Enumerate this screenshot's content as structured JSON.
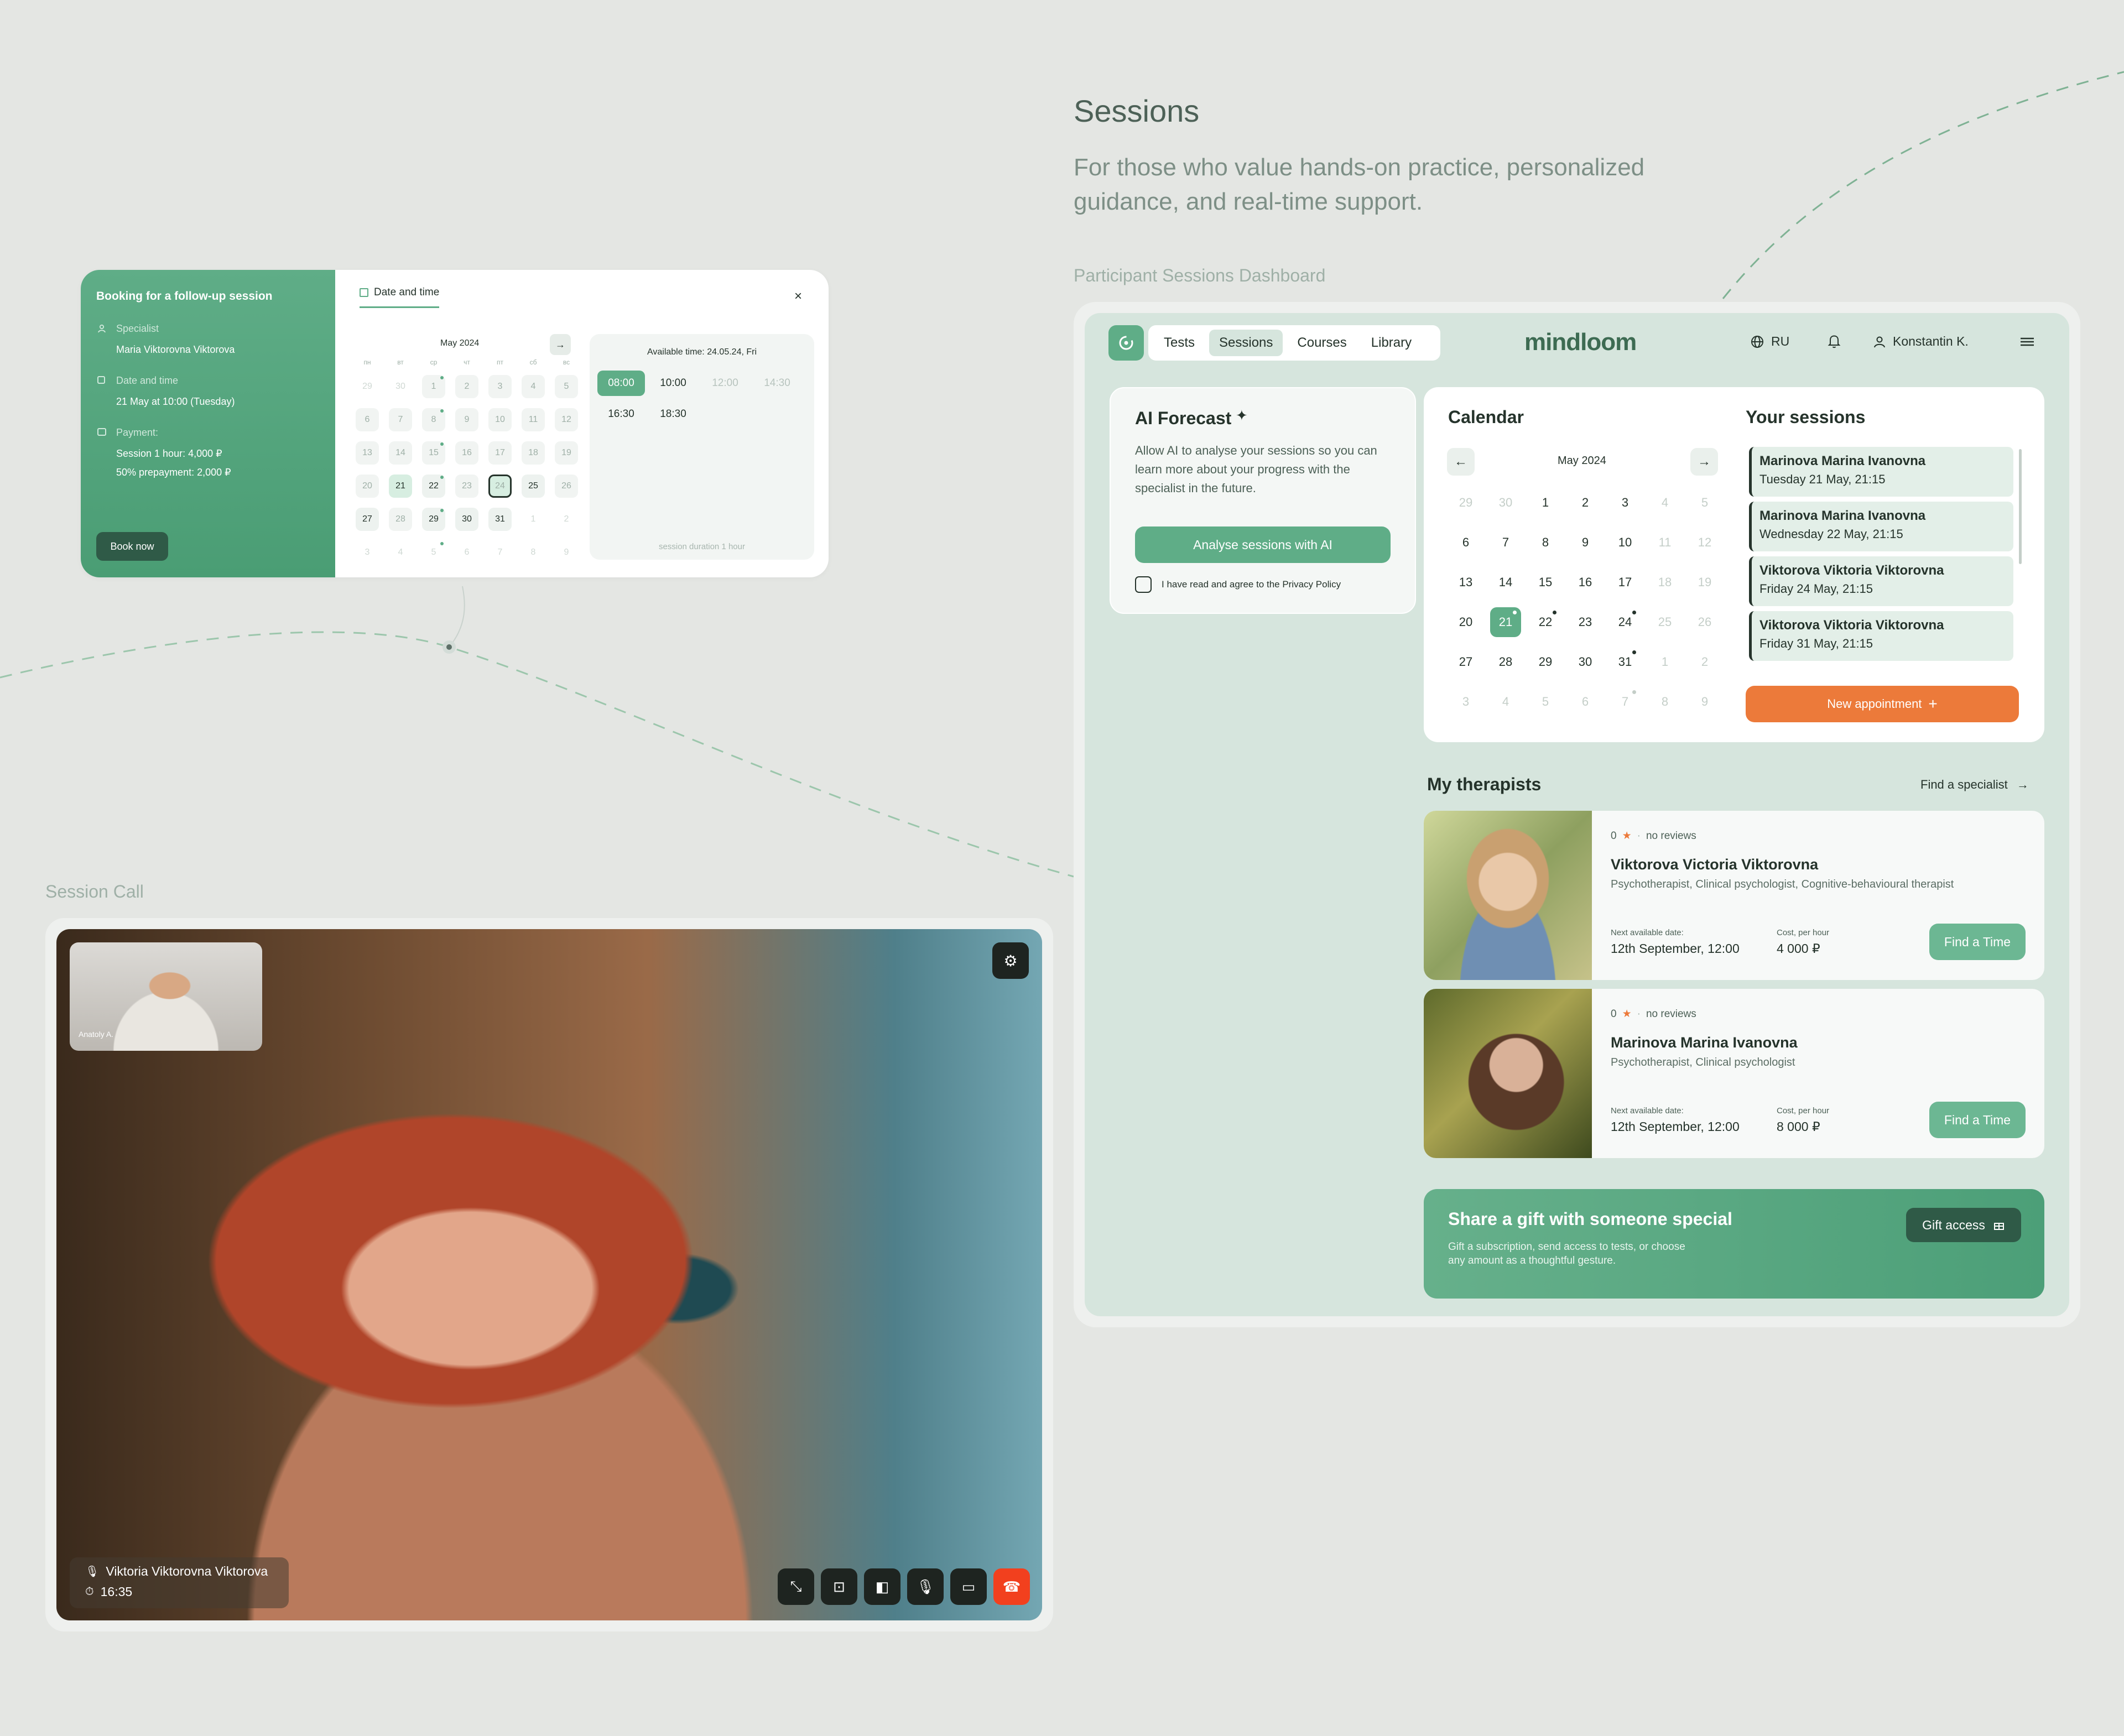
{
  "header": {
    "title": "Sessions",
    "subtitle": "For those who value hands-on practice, personalized guidance, and real-time support.",
    "dashboard_caption": "Participant Sessions Dashboard",
    "call_caption": "Session Call"
  },
  "booking": {
    "title": "Booking for a follow-up session",
    "specialist_label": "Specialist",
    "specialist_value": "Maria Viktorovna Viktorova",
    "date_label": "Date and time",
    "date_value": "21 May at 10:00 (Tuesday)",
    "payment_label": "Payment:",
    "payment_line1": "Session 1 hour: 4,000 ₽",
    "payment_line2": "50% prepayment: 2,000 ₽",
    "book_button": "Book now",
    "tab_label": "Date and time",
    "close_icon": "×",
    "month": "May 2024",
    "next_icon": "→",
    "weekdays": [
      "пн",
      "вт",
      "ср",
      "чт",
      "пт",
      "сб",
      "вс"
    ],
    "days": [
      {
        "d": "29",
        "k": "o"
      },
      {
        "d": "30",
        "k": "o"
      },
      {
        "d": "1",
        "k": "p",
        "dot": true
      },
      {
        "d": "2",
        "k": "p"
      },
      {
        "d": "3",
        "k": "p"
      },
      {
        "d": "4",
        "k": "p"
      },
      {
        "d": "5",
        "k": "p"
      },
      {
        "d": "6",
        "k": "p"
      },
      {
        "d": "7",
        "k": "p"
      },
      {
        "d": "8",
        "k": "p",
        "dot": true
      },
      {
        "d": "9",
        "k": "p"
      },
      {
        "d": "10",
        "k": "p"
      },
      {
        "d": "11",
        "k": "p"
      },
      {
        "d": "12",
        "k": "p"
      },
      {
        "d": "13",
        "k": "p"
      },
      {
        "d": "14",
        "k": "p"
      },
      {
        "d": "15",
        "k": "p",
        "dot": true
      },
      {
        "d": "16",
        "k": "p"
      },
      {
        "d": "17",
        "k": "p"
      },
      {
        "d": "18",
        "k": "p"
      },
      {
        "d": "19",
        "k": "p"
      },
      {
        "d": "20",
        "k": "p"
      },
      {
        "d": "21",
        "k": "g"
      },
      {
        "d": "22",
        "k": "m",
        "dot": true
      },
      {
        "d": "23",
        "k": "p"
      },
      {
        "d": "24",
        "k": "s"
      },
      {
        "d": "25",
        "k": "m"
      },
      {
        "d": "26",
        "k": "p"
      },
      {
        "d": "27",
        "k": "m"
      },
      {
        "d": "28",
        "k": "p"
      },
      {
        "d": "29",
        "k": "m",
        "dot": true
      },
      {
        "d": "30",
        "k": "m"
      },
      {
        "d": "31",
        "k": "m"
      },
      {
        "d": "1",
        "k": "o"
      },
      {
        "d": "2",
        "k": "o"
      },
      {
        "d": "3",
        "k": "o"
      },
      {
        "d": "4",
        "k": "o"
      },
      {
        "d": "5",
        "k": "o",
        "dot": true
      },
      {
        "d": "6",
        "k": "o"
      },
      {
        "d": "7",
        "k": "o"
      },
      {
        "d": "8",
        "k": "o"
      },
      {
        "d": "9",
        "k": "o"
      }
    ],
    "available_title": "Available time: 24.05.24, Fri",
    "slots": [
      {
        "t": "08:00",
        "k": "sel"
      },
      {
        "t": "10:00",
        "k": ""
      },
      {
        "t": "12:00",
        "k": "dim"
      },
      {
        "t": "14:30",
        "k": "dim"
      },
      {
        "t": "16:30",
        "k": ""
      },
      {
        "t": "18:30",
        "k": ""
      }
    ],
    "duration": "session duration 1 hour"
  },
  "dashboard": {
    "nav": [
      {
        "label": "Tests",
        "active": false
      },
      {
        "label": "Sessions",
        "active": true
      },
      {
        "label": "Courses",
        "active": false
      },
      {
        "label": "Library",
        "active": false
      }
    ],
    "brand": "mindloom",
    "lang": "RU",
    "user": "Konstantin K.",
    "ai": {
      "title": "AI Forecast",
      "desc": "Allow AI to analyse your sessions so you can learn more about your progress with the specialist in the future.",
      "button": "Analyse sessions with AI",
      "agree": "I have read and agree to the Privacy Policy"
    },
    "calendar": {
      "title": "Calendar",
      "month": "May 2024",
      "prev_icon": "←",
      "next_icon": "→",
      "days": [
        {
          "d": "29",
          "k": "o"
        },
        {
          "d": "30",
          "k": "o"
        },
        {
          "d": "1",
          "k": ""
        },
        {
          "d": "2",
          "k": ""
        },
        {
          "d": "3",
          "k": ""
        },
        {
          "d": "4",
          "k": "o"
        },
        {
          "d": "5",
          "k": "o"
        },
        {
          "d": "6",
          "k": ""
        },
        {
          "d": "7",
          "k": ""
        },
        {
          "d": "8",
          "k": ""
        },
        {
          "d": "9",
          "k": ""
        },
        {
          "d": "10",
          "k": ""
        },
        {
          "d": "11",
          "k": "o"
        },
        {
          "d": "12",
          "k": "o"
        },
        {
          "d": "13",
          "k": ""
        },
        {
          "d": "14",
          "k": ""
        },
        {
          "d": "15",
          "k": ""
        },
        {
          "d": "16",
          "k": ""
        },
        {
          "d": "17",
          "k": ""
        },
        {
          "d": "18",
          "k": "o"
        },
        {
          "d": "19",
          "k": "o"
        },
        {
          "d": "20",
          "k": ""
        },
        {
          "d": "21",
          "k": "sel",
          "dot": true
        },
        {
          "d": "22",
          "k": "",
          "dot": true
        },
        {
          "d": "23",
          "k": ""
        },
        {
          "d": "24",
          "k": "",
          "dot": true
        },
        {
          "d": "25",
          "k": "o"
        },
        {
          "d": "26",
          "k": "o"
        },
        {
          "d": "27",
          "k": ""
        },
        {
          "d": "28",
          "k": ""
        },
        {
          "d": "29",
          "k": ""
        },
        {
          "d": "30",
          "k": ""
        },
        {
          "d": "31",
          "k": "",
          "dot": true
        },
        {
          "d": "1",
          "k": "o"
        },
        {
          "d": "2",
          "k": "o"
        },
        {
          "d": "3",
          "k": "o"
        },
        {
          "d": "4",
          "k": "o"
        },
        {
          "d": "5",
          "k": "o"
        },
        {
          "d": "6",
          "k": "o"
        },
        {
          "d": "7",
          "k": "o",
          "dot": true
        },
        {
          "d": "8",
          "k": "o"
        },
        {
          "d": "9",
          "k": "o"
        }
      ]
    },
    "sessions": {
      "title": "Your sessions",
      "items": [
        {
          "name": "Marinova Marina Ivanovna",
          "when": "Tuesday 21 May, 21:15"
        },
        {
          "name": "Marinova Marina Ivanovna",
          "when": "Wednesday 22 May, 21:15"
        },
        {
          "name": "Viktorova Viktoria Viktorovna",
          "when": "Friday 24 May, 21:15"
        },
        {
          "name": "Viktorova Viktoria Viktorovna",
          "when": "Friday 31 May, 21:15"
        }
      ],
      "new_button": "New appointment"
    },
    "therapists": {
      "title": "My therapists",
      "find_link": "Find a specialist",
      "items": [
        {
          "rating": "0",
          "reviews": "no reviews",
          "name": "Viktorova Victoria Viktorovna",
          "spec": "Psychotherapist, Clinical psychologist, Cognitive-behavioural therapist",
          "date_label": "Next available date:",
          "date": "12th September, 12:00",
          "cost_label": "Cost, per hour",
          "cost": "4 000 ₽",
          "button": "Find a Time"
        },
        {
          "rating": "0",
          "reviews": "no reviews",
          "name": "Marinova Marina Ivanovna",
          "spec": "Psychotherapist, Clinical psychologist",
          "date_label": "Next available date:",
          "date": "12th September, 12:00",
          "cost_label": "Cost, per hour",
          "cost": "8 000 ₽",
          "button": "Find a Time"
        }
      ]
    },
    "gift": {
      "title": "Share a gift with someone special",
      "desc": "Gift a subscription, send access to tests, or choose any amount as a thoughtful gesture.",
      "button": "Gift access"
    }
  },
  "call": {
    "pip_name": "Anatoly A.",
    "speaker": "Viktoria Viktorovna Viktorova",
    "timer": "16:35"
  },
  "colors": {
    "accent": "#5fad87",
    "accent_dark": "#2f5a47",
    "orange": "#ec7a3a",
    "end_call": "#f2401e"
  }
}
